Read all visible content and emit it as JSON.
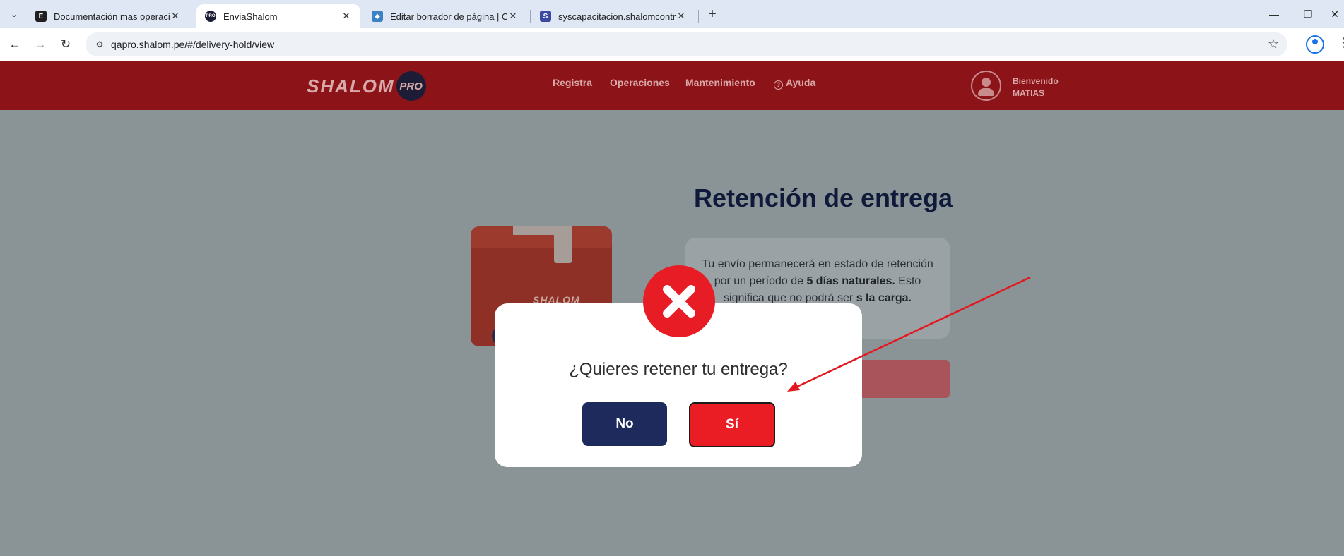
{
  "browser": {
    "tabs": [
      {
        "title": "Documentación mas operaciones",
        "favicon": "E",
        "favicon_color": "#1f1f1f",
        "active": false
      },
      {
        "title": "EnviaShalom",
        "favicon": "PRO",
        "favicon_color": "#1c1c36",
        "active": true
      },
      {
        "title": "Editar borrador de página | Overview",
        "favicon": "layers",
        "favicon_color": "#3b82c4",
        "active": false
      },
      {
        "title": "syscapacitacion.shalomcontrol.com",
        "favicon": "S",
        "favicon_color": "#3b4aa0",
        "active": false
      }
    ],
    "url": "qapro.shalom.pe/#/delivery-hold/view"
  },
  "header": {
    "logo_text": "SHALOM",
    "logo_badge": "PRO",
    "nav": [
      "Registra",
      "Operaciones",
      "Mantenimiento",
      "Ayuda"
    ],
    "welcome_label": "Bienvenido",
    "user_name": "MATIAS"
  },
  "page": {
    "title": "Retención de entrega",
    "info": {
      "part1": "Tu envío permanecerá en estado de retención por un período de ",
      "bold1": "5 días naturales.",
      "part2": " Esto significa que no podrá ser ",
      "bold2": "s la carga."
    },
    "box_brand": "SHALOM"
  },
  "modal": {
    "question": "¿Quieres retener tu entrega?",
    "no_label": "No",
    "si_label": "Sí"
  },
  "colors": {
    "header_bg": "#8c1418",
    "primary_navy": "#1e2a5c",
    "danger_red": "#ea1c24",
    "overlay": "#8a9497"
  }
}
